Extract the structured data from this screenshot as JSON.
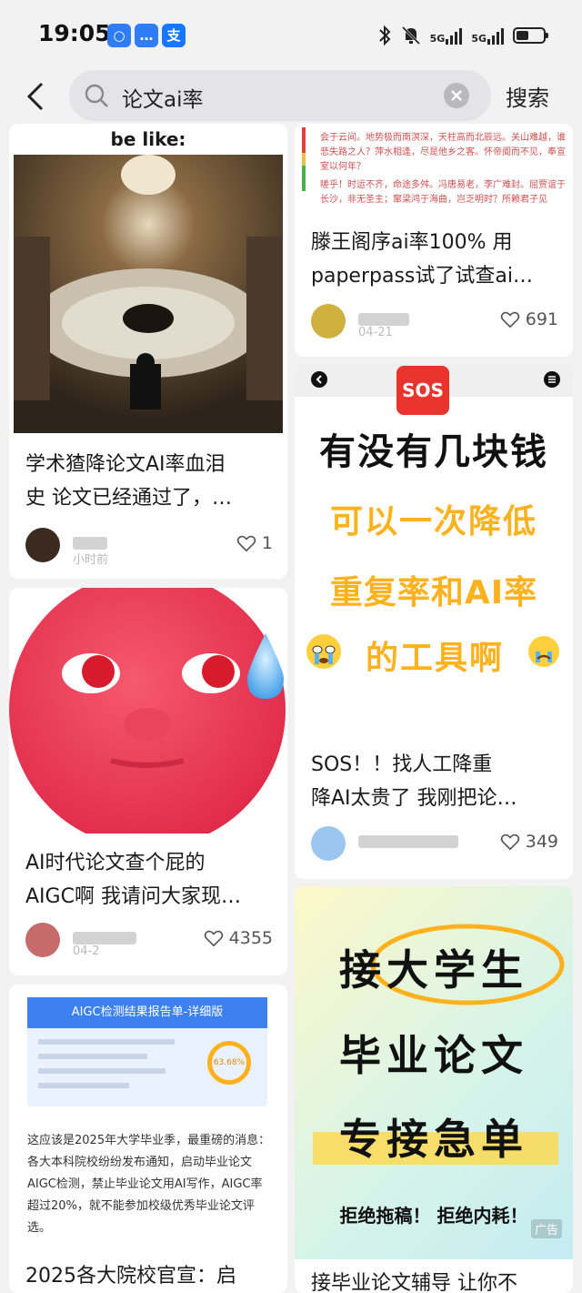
{
  "status": {
    "time": "19:05",
    "badges": [
      "○",
      "…",
      "支"
    ],
    "net1": "5G",
    "net2": "5G"
  },
  "search": {
    "query": "论文ai率",
    "button": "搜索"
  },
  "cards": {
    "c1": {
      "caption": "be like:",
      "title_line1": "学术猹降论文AI率血泪",
      "title_line2": "史 论文已经通过了，…",
      "date": "小时前",
      "likes": "1"
    },
    "c2": {
      "title_line1": "AI时代论文查个屁的",
      "title_line2": "AIGC啊 我请问大家现…",
      "date": "04-2",
      "likes": "4355"
    },
    "c3": {
      "report_title": "AIGC检测结果报告单-详细版",
      "percent": "63.68%",
      "body": "这应该是2025年大学毕业季，最重磅的消息：各大本科院校纷纷发布通知，启动毕业论文AIGC检测，禁止毕业论文用AI写作，AIGC率超过20%，就不能参加校级优秀毕业论文评选。",
      "title_line1": "2025各大院校官宣：启"
    },
    "c4": {
      "poem_line1": "会于云间。地势极而南溟深，天柱高而北辰远。关山难越，谁悲失路之人？萍水相逢，尽是他乡之客。怀帝阍而不见，奉宣室以何年？",
      "poem_line2": "嗟乎！时运不齐，命途多舛。冯唐易老，李广难封。屈贾谊于长沙，非无圣主；窜梁鸿于海曲，岂乏明时？所赖君子见",
      "title_line1": "滕王阁序ai率100% 用",
      "title_line2": "paperpass试了试查ai…",
      "date": "04-21",
      "likes": "691"
    },
    "c5": {
      "sos": "SOS",
      "line1": "有没有几块钱",
      "line2": "可以一次降低",
      "line3": "重复率和AI率",
      "line4": "的工具啊",
      "title_line1": "SOS！！找人工降重",
      "title_line2": "降AI太贵了 我刚把论…",
      "date": "",
      "likes": "349"
    },
    "c6": {
      "line1": "接大学生",
      "line2": "毕业论文",
      "line3": "专接急单",
      "line4": "拒绝拖稿！ 拒绝内耗！",
      "ad": "广告",
      "title_line1": "接毕业论文辅导 让你不"
    }
  },
  "colors": {
    "accent": "#ffb21e",
    "sos_red": "#e8342c",
    "like": "#555555"
  }
}
